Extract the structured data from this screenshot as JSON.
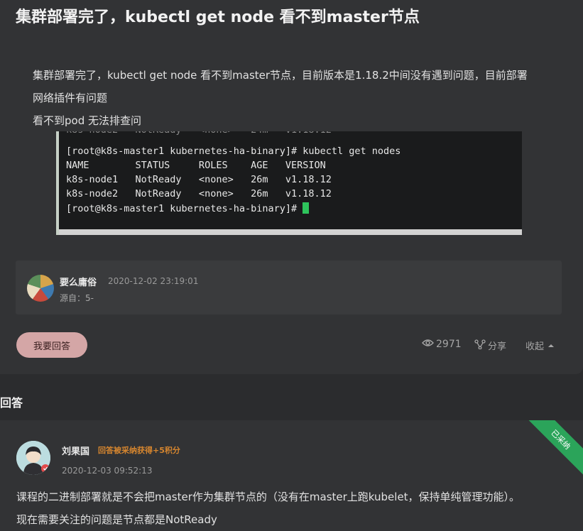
{
  "question": {
    "title": "集群部署完了，kubectl get node 看不到master节点",
    "body_lines": [
      "集群部署完了，kubectl get node 看不到master节点，目前版本是1.18.2中间没有遇到问题，目前部署",
      "网络插件有问题",
      "看不到pod 无法排查问"
    ]
  },
  "terminal": {
    "lines": [
      "[root@k8s-master1 kubernetes-ha-binary]# kubectl get nodes",
      "NAME        STATUS     ROLES    AGE   VERSION",
      "k8s-node1   NotReady   <none>   26m   v1.18.12",
      "k8s-node2   NotReady   <none>   26m   v1.18.12"
    ],
    "prompt": "[root@k8s-master1 kubernetes-ha-binary]# "
  },
  "author": {
    "name": "要么庸俗",
    "time": "2020-12-02 23:19:01",
    "source": "源自：5-"
  },
  "actions": {
    "answer_button": "我要回答",
    "views": "2971",
    "share": "分享",
    "collapse": "收起"
  },
  "answers_header": "回答",
  "answer": {
    "accepted_label": "已采纳",
    "name": "刘果国",
    "badge": "回答被采纳获得+5积分",
    "time": "2020-12-03 09:52:13",
    "text_lines": [
      "课程的二进制部署就是不会把master作为集群节点的（没有在master上跑kubelet，保持单纯管理功能）。",
      "现在需要关注的问题是节点都是NotReady"
    ]
  },
  "colors": {
    "background": "#2b2c2e",
    "card": "#323335",
    "accent_button": "#d4a6a6",
    "accepted": "#2ba45a",
    "badge": "#d6862f",
    "cursor": "#2ec45c"
  }
}
